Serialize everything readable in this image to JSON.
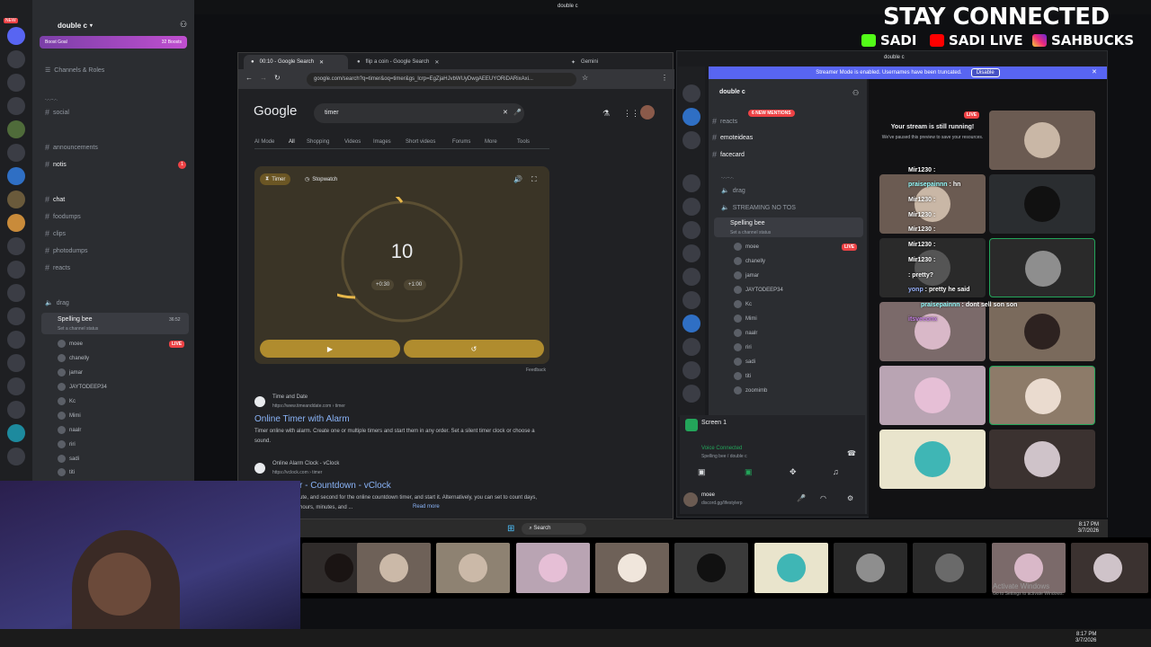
{
  "titlebar": {
    "title": "double c"
  },
  "left_discord": {
    "new_badge": "NEW",
    "server_name": "double c",
    "boost_goal": "Boost Goal",
    "boost_count": "32 Boosts",
    "channels_roles": "Channels & Roles",
    "category1": "-.-.--.-.",
    "channels": [
      {
        "name": "social"
      },
      {
        "name": "announcements"
      },
      {
        "name": "notis",
        "badge": "1"
      },
      {
        "name": "chat"
      },
      {
        "name": "foodumps"
      },
      {
        "name": "clips"
      },
      {
        "name": "photodumps"
      },
      {
        "name": "reacts"
      }
    ],
    "drag": "drag",
    "voice_channel": "Spelling bee",
    "voice_time": "36:52",
    "voice_status": "Set a channel status",
    "users": [
      "moee",
      "chanelly",
      "jamar",
      "JAYTODEEP34",
      "Kc",
      "Mimi",
      "naalr",
      "riri",
      "sadi",
      "titi"
    ],
    "live_label": "LIVE"
  },
  "chrome": {
    "tab1": "00:10 - Google Search",
    "tab2": "flip a coin - Google Search",
    "gemini": "Gemini",
    "url": "google.com/search?q=timer&oq=timer&gs_lcrp=EgZjaHJvbWUyDwgAEEUYORiDARixAxi...",
    "logo": "Google",
    "query": "timer",
    "tabs": [
      "AI Mode",
      "All",
      "Shopping",
      "Videos",
      "Images",
      "Short videos",
      "Forums",
      "More",
      "Tools"
    ],
    "timer_label": "Timer",
    "stopwatch_label": "Stopwatch",
    "time_value": "10",
    "plus30": "+0:30",
    "plus100": "+1:00",
    "feedback": "Feedback",
    "result1": {
      "source": "Time and Date",
      "url": "https://www.timeanddate.com › timer",
      "title": "Online Timer with Alarm",
      "snippet": "Timer online with alarm. Create one or multiple timers and start them in any order. Set a silent timer clock or choose a sound."
    },
    "result2": {
      "source": "Online Alarm Clock - vClock",
      "url": "https://vclock.com › timer",
      "title": "r - Countdown - vClock",
      "snippet": "ute, and second for the online countdown timer, and start it. Alternatively, you can set to count days, hours, minutes, and ...",
      "read_more": "Read more"
    }
  },
  "right_discord": {
    "title": "double c",
    "banner": "Streamer Mode is enabled. Usernames have been truncated.",
    "disable": "Disable",
    "server_name": "double c",
    "mentions": "6 NEW MENTIONS",
    "channels": [
      "reacts",
      "emoteideas",
      "facecard"
    ],
    "category": "-.-.--.-.",
    "drag": "drag",
    "streaming": "STREAMING NO TOS",
    "voice_channel": "Spelling bee",
    "voice_status": "Set a channel status",
    "users": [
      "moee",
      "chanelly",
      "jamar",
      "JAYTODEEP34",
      "Kc",
      "Mimi",
      "naalr",
      "riri",
      "sadi",
      "titi",
      "zoomimb"
    ],
    "screen": "Screen 1",
    "voice_connected": "Voice Connected",
    "voice_sub": "Spelling bee / double c",
    "self_name": "moee",
    "self_sub": "discord.gg/lifestylerp",
    "stream_running": "Your stream is still running!",
    "stream_paused": "We've paused this preview to save your resources.",
    "live": "LIVE"
  },
  "chat": [
    {
      "user": "Mir1230",
      "msg": ""
    },
    {
      "user": "praisepainnn",
      "msg": "hn"
    },
    {
      "user": "Mir1230",
      "msg": ""
    },
    {
      "user": "Mir1230",
      "msg": ""
    },
    {
      "user": "Mir1230",
      "msg": ""
    },
    {
      "user": "Mir1230",
      "msg": ""
    },
    {
      "user": "Mir1230",
      "msg": ""
    },
    {
      "user": "",
      "msg": "pretty?"
    },
    {
      "user": "yonp",
      "msg": "pretty he said"
    },
    {
      "user": "praisepainnn",
      "msg": "dont sell son son"
    },
    {
      "user": "itsveeonx",
      "msg": ""
    }
  ],
  "overlay": {
    "stay_connected": "STAY CONNECTED",
    "kick": "SADI",
    "youtube": "SADI LIVE",
    "instagram": "SAHBUCKS"
  },
  "taskbar": {
    "search": "Search",
    "time": "8:17 PM",
    "date": "3/7/2026",
    "activate": "Activate Windows",
    "activate_sub": "Go to Settings to activate Windows."
  },
  "colors": {
    "discord_bg": "#2b2d31",
    "accent": "#5865f2",
    "timer_gold": "#b08c2e",
    "link": "#8ab4f8",
    "live_red": "#ed4245"
  }
}
